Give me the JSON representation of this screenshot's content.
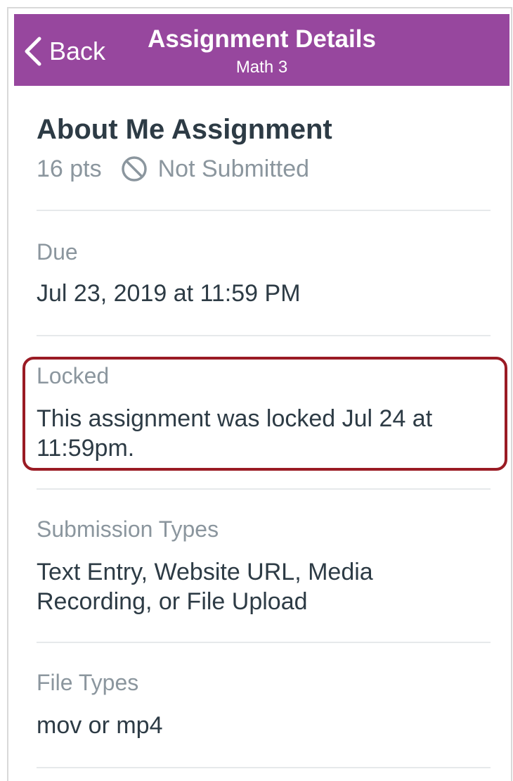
{
  "header": {
    "back_label": "Back",
    "title": "Assignment Details",
    "subtitle": "Math 3",
    "background": "#97479e"
  },
  "assignment": {
    "title": "About Me Assignment",
    "points": "16 pts",
    "status_icon": "not-submitted-icon",
    "status": "Not Submitted"
  },
  "sections": {
    "due": {
      "label": "Due",
      "value": "Jul 23, 2019 at 11:59 PM"
    },
    "locked": {
      "label": "Locked",
      "value": "This assignment was locked Jul 24 at 11:59pm."
    },
    "submission_types": {
      "label": "Submission Types",
      "value": "Text Entry, Website URL, Media Recording, or File Upload"
    },
    "file_types": {
      "label": "File Types",
      "value": "mov or mp4"
    }
  },
  "annotation": {
    "highlight_color": "#9a1b24"
  }
}
